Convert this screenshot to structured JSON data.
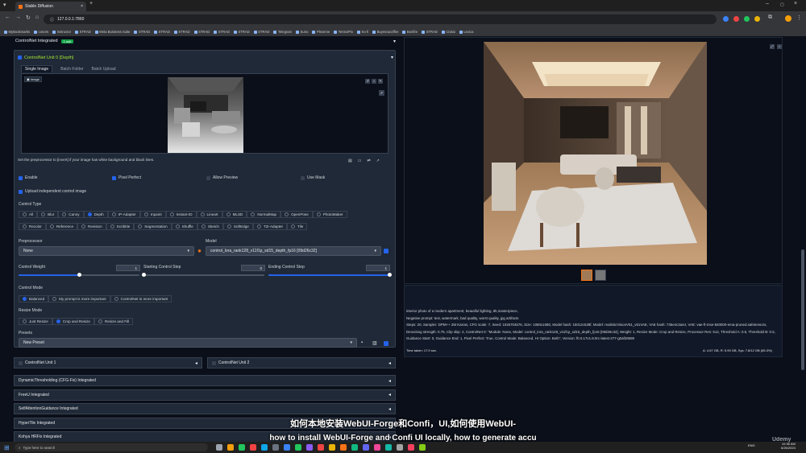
{
  "browser": {
    "tab_title": "Stable Diffusion",
    "url": "127.0.0.1:7860",
    "bookmarks": [
      "MyBookmarks",
      "conors",
      "Instructor",
      "STRAD",
      "Meta Business Suite",
      "STRAD",
      "STRAD",
      "STRAD",
      "STRAD",
      "STRAD",
      "STRAD",
      "STRAD",
      "Telegram",
      "Suno",
      "Plexeme",
      "TensorPix",
      "Ko-fi",
      "Buymeacoffee",
      "Bonfire",
      "STRAD",
      "Civitai",
      "Lexica"
    ]
  },
  "controlnet": {
    "header": "ControlNet Integrated",
    "badge": "1 unit",
    "unit0_title": "ControlNet Unit 0 [Depth]",
    "tabs": [
      "Single Image",
      "Batch Folder",
      "Batch Upload"
    ],
    "image_label": "Image",
    "hint": "Set the preprocessor to [invert] if your image has white background and black lines.",
    "enable": "Enable",
    "pixel_perfect": "Pixel Perfect",
    "allow_preview": "Allow Preview",
    "use_mask": "Use Mask",
    "upload_independent": "Upload independent control image",
    "control_type_label": "Control Type",
    "control_types_row1": [
      "All",
      "Blur",
      "Canny",
      "Depth",
      "IP-Adapter",
      "Inpaint",
      "Instant-ID",
      "Lineart",
      "MLSD",
      "NormalMap",
      "OpenPose",
      "PhotoMaker"
    ],
    "control_types_row2": [
      "Recolor",
      "Reference",
      "Revision",
      "Scribble",
      "Segmentation",
      "Shuffle",
      "Sketch",
      "SoftEdge",
      "T2I-Adapter",
      "Tile"
    ],
    "selected_type": "Depth",
    "preprocessor_label": "Preprocessor",
    "preprocessor_value": "None",
    "model_label": "Model",
    "model_value": "control_lora_rank128_v11f1p_sd15_depth_fp16 [09d26c32]",
    "weight_label": "Control Weight",
    "weight_value": "1",
    "start_label": "Starting Control Step",
    "start_value": "0",
    "end_label": "Ending Control Step",
    "end_value": "1",
    "weight_fraction": 0.5,
    "start_fraction": 0,
    "end_fraction": 1,
    "control_mode_label": "Control Mode",
    "control_modes": [
      "Balanced",
      "My prompt is more important",
      "ControlNet is more important"
    ],
    "resize_mode_label": "Resize Mode",
    "resize_modes": [
      "Just Resize",
      "Crop and Resize",
      "Resize and Fill"
    ],
    "presets_label": "Presets",
    "preset_value": "New Preset",
    "unit1": "ControlNet Unit 1",
    "unit2": "ControlNet Unit 2"
  },
  "accordions": [
    "DynamicThresholding (CFG-Fix) Integrated",
    "FreeU Integrated",
    "SelfAttentionGuidance Integrated",
    "HyperTile Integrated",
    "Kohya HRFix Integrated"
  ],
  "output": {
    "info_text": "interior photo of a modern apartment, beautiful lighting, 8k,masterpiece,\nNegative prompt: text, watermark, bad quality, worst quality, jpg artifacts\nSteps: 20, Sampler: DPM++ 2M Karras, CFG scale: 7, Seed: 1026704676, Size: 1080x1080, Model hash: 15012c538f, Model: realisticVisionV51_v51VAE, VAE hash: 735e4c3a44, VAE: vae-ft-mse-840000-ema-pruned.safetensors, Denoising strength: 0.75, Clip skip: 2, ControlNet 0: \"Module: None, Model: control_lora_rank128_v11f1p_sd15_depth_fp16 [09d26c32], Weight: 1, Resize Mode: Crop and Resize, Processor Res: 512, Threshold A: 0.5, Threshold B: 0.5, Guidance Start: 0, Guidance End: 1, Pixel Perfect: True, Control Mode: Balanced, Hr Option: Both\", Version: f0.0.17v1.8.0rc-latest-277-g0af28699",
    "time_taken": "Time taken: 17.9 sec.",
    "vram": "A: 4.67 GB, R: 5.99 GB, Sys: 7.8/12 GB (65.3%)"
  },
  "subtitle": {
    "zh": "如何本地安装WebUI-Forge和Confi，UI,如何使用WebUI-",
    "en": "how to install WebUI-Forge and Confi UI locally, how to generate accu"
  },
  "taskbar": {
    "search_placeholder": "Type here to search",
    "time": "10:36 AM",
    "date": "6/26/2024",
    "lang": "ENG",
    "watermark": "Udemy"
  }
}
